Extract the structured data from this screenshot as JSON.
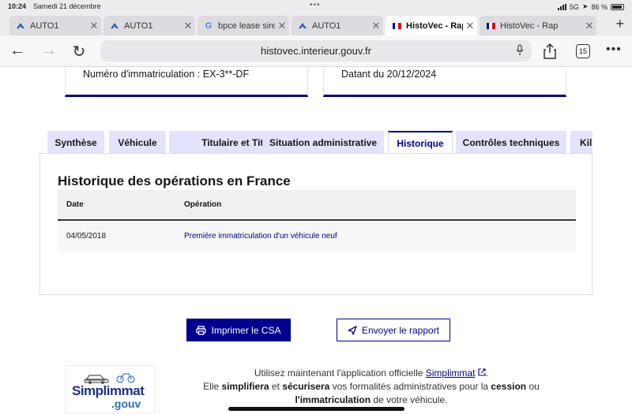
{
  "status_bar": {
    "time": "10:24",
    "date": "Samedi 21 décembre",
    "network": "5G",
    "battery": "86 %"
  },
  "browser_tabs": [
    {
      "title": "AUTO1",
      "favicon": "auto1-icon",
      "active": false
    },
    {
      "title": "AUTO1",
      "favicon": "auto1-icon",
      "active": false
    },
    {
      "title": "bpce lease sire",
      "favicon": "google-icon",
      "active": false
    },
    {
      "title": "AUTO1",
      "favicon": "auto1-icon",
      "active": false
    },
    {
      "title": "HistoVec - Rap",
      "favicon": "french-flag-icon",
      "active": true
    },
    {
      "title": "HistoVec - Rap",
      "favicon": "french-flag-icon",
      "active": false
    }
  ],
  "toolbar": {
    "url": "histovec.interieur.gouv.fr",
    "tab_count": "15"
  },
  "cards": {
    "left": "Numéro d'immatriculation : EX-3**-DF",
    "right": "Datant du 20/12/2024"
  },
  "page_tabs": [
    {
      "label": "Synthèse",
      "active": false
    },
    {
      "label": "Véhicule",
      "active": false
    },
    {
      "label": "Titulaire et Titre",
      "active": false
    },
    {
      "label": "Situation administrative",
      "active": false
    },
    {
      "label": "Historique",
      "active": true
    },
    {
      "label": "Contrôles techniques",
      "active": false
    },
    {
      "label": "Kil",
      "active": false
    }
  ],
  "history": {
    "heading": "Historique des opérations en France",
    "columns": [
      "Date",
      "Opération"
    ],
    "rows": [
      {
        "date": "04/05/2018",
        "operation": "Première immatriculation d'un véhicule neuf"
      }
    ]
  },
  "actions": {
    "print_label": "Imprimer le CSA",
    "send_label": "Envoyer le rapport"
  },
  "promo": {
    "logo_text": "Simplimmat",
    "logo_suffix": ".gouv",
    "line1_prefix": "Utilisez maintenant l'application officielle",
    "line1_link": "Simplimmat",
    "line1_suffix": ".",
    "line2_a": "Elle",
    "line2_b": "simplifiera",
    "line2_c": "et",
    "line2_d": "sécurisera",
    "line2_e": "vos formalités administratives pour la",
    "line2_f": "cession",
    "line2_g": "ou",
    "line3_a": "l'immatriculation",
    "line3_b": "de votre véhicule."
  },
  "colors": {
    "accent": "#000091",
    "tab_bg": "#e3e3fd"
  }
}
